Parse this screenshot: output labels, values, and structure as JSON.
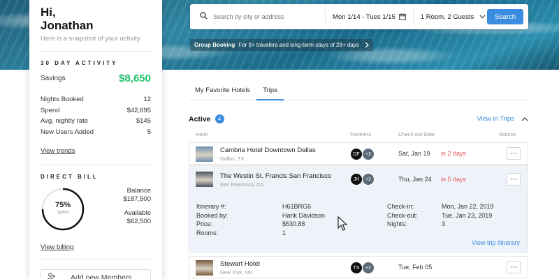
{
  "user": {
    "greeting": "Hi,",
    "name": "Jonathan",
    "subtitle": "Here is a snapshot of your activity"
  },
  "activity": {
    "title": "30 DAY ACTIVITY",
    "savings_label": "Savings",
    "savings_value": "$8,650",
    "stats": [
      {
        "label": "Nights Booked",
        "value": "12"
      },
      {
        "label": "Spend",
        "value": "$42,695"
      },
      {
        "label": "Avg. nightly rate",
        "value": "$145"
      },
      {
        "label": "New Users Added",
        "value": "5"
      }
    ],
    "view_trends": "View trends"
  },
  "direct_bill": {
    "title": "DIRECT BILL",
    "percent_text": "75%",
    "percent_value": 0.75,
    "percent_sub": "spent",
    "balance_label": "Balance",
    "balance_value": "$187,500",
    "available_label": "Available",
    "available_value": "$62,500",
    "view_billing": "View billing"
  },
  "add_members": {
    "label": "Add new Members",
    "icon": "add-user-icon"
  },
  "search": {
    "placeholder": "Search by city or address",
    "dates": "Mon 1/14 - Tues 1/15",
    "guests": "1 Room, 2 Guests",
    "button": "Search"
  },
  "group_booking": {
    "title": "Group Booking",
    "text": "For 9+ travelers and long-term stays of 28+ days"
  },
  "tabs": [
    {
      "label": "My Favorite Hotels",
      "active": false
    },
    {
      "label": "Trips",
      "active": true
    }
  ],
  "active_section": {
    "title": "Active",
    "count": "4",
    "view_link": "View in Trips"
  },
  "columns": {
    "hotel": "Hotel",
    "travelers": "Travelers",
    "checkout": "Check-out Date",
    "actions": "Actions"
  },
  "trips": [
    {
      "name": "Cambria Hotel Downtown Dallas",
      "location": "Dallas, TX",
      "traveler": "DF",
      "extra": "+2",
      "checkout": "Sat, Jan 19",
      "due": "in 2 days",
      "thumb_color": "#6f8fae"
    },
    {
      "name": "The Westin St. Francis San Francisco",
      "location": "San Francisco, CA",
      "traveler": "JH",
      "extra": "+2",
      "checkout": "Thu, Jan 24",
      "due": "in 5 days",
      "thumb_color": "#4a5560"
    },
    {
      "name": "Stewart Hotel",
      "location": "New York, NY",
      "traveler": "TS",
      "extra": "+2",
      "checkout": "Tue, Feb 05",
      "due": "",
      "thumb_color": "#7a5a3c"
    }
  ],
  "details": {
    "itinerary_label": "Itinerary #:",
    "itinerary_value": "H61BRG6",
    "booked_by_label": "Booked by:",
    "booked_by_value": "Hank Davidson",
    "price_label": "Price:",
    "price_value": "$530.88",
    "rooms_label": "Rooms:",
    "rooms_value": "1",
    "checkin_label": "Check-in:",
    "checkin_value": "Mon, Jan 22, 2019",
    "checkout_label": "Check-out:",
    "checkout_value": "Tue, Jan 23, 2019",
    "nights_label": "Nights:",
    "nights_value": "3",
    "view_itinerary": "View trip itinerary"
  },
  "colors": {
    "accent": "#3a8de0",
    "savings": "#1fbf6b",
    "due": "#e05656"
  }
}
